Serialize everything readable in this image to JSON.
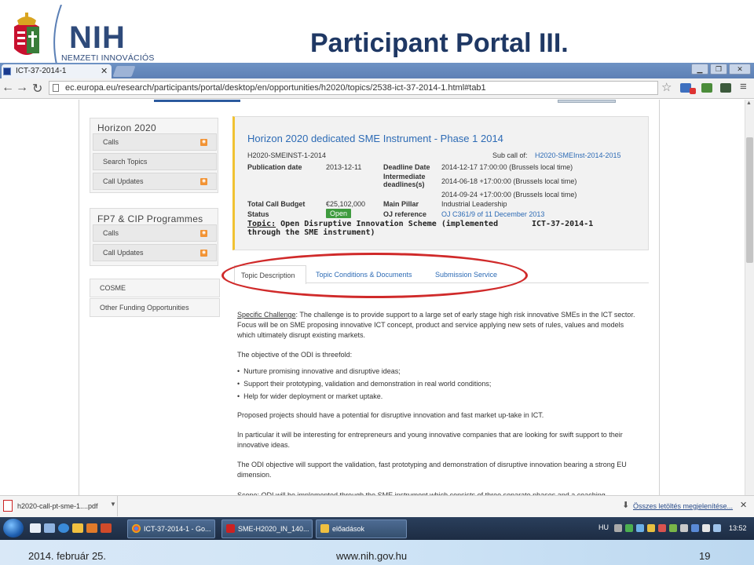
{
  "slide": {
    "title": "Participant Portal III.",
    "logo_text": "NIH",
    "logo_subtitle": "NEMZETI INNOVÁCIÓS",
    "footer_date": "2014. február 25.",
    "footer_url": "www.nih.gov.hu",
    "page_number": "19"
  },
  "browser": {
    "tab_title": "ICT-37-2014-1",
    "url": "ec.europa.eu/research/participants/portal/desktop/en/opportunities/h2020/topics/2538-ict-37-2014-1.html#tab1"
  },
  "sidebar": {
    "horizon_heading": "Horizon 2020",
    "horizon_items": [
      "Calls",
      "Search Topics",
      "Call Updates"
    ],
    "fp7_heading": "FP7 & CIP Programmes",
    "fp7_items": [
      "Calls",
      "Call Updates"
    ],
    "cosme": "COSME",
    "other_funding": "Other Funding Opportunities"
  },
  "call": {
    "title": "Horizon 2020 dedicated SME Instrument - Phase 1 2014",
    "identifier": "H2020-SMEINST-1-2014",
    "subcall_label": "Sub call of:",
    "subcall_value": "H2020-SMEInst-2014-2015",
    "publication_date_label": "Publication date",
    "publication_date": "2013-12-11",
    "deadline_label": "Deadline Date",
    "deadline": "2014-12-17 17:00:00 (Brussels local time)",
    "intermediate_label_1": "Intermediate",
    "intermediate_label_2": "deadlines(s)",
    "intermediate_1": "2014-06-18 +17:00:00 (Brussels local time)",
    "intermediate_2": "2014-09-24 +17:00:00 (Brussels local time)",
    "budget_label": "Total Call Budget",
    "budget": "€25,102,000",
    "pillar_label": "Main Pillar",
    "pillar": "Industrial Leadership",
    "status_label": "Status",
    "status": "Open",
    "oj_label": "OJ reference",
    "oj": "OJ C361/9 of 11 December 2013",
    "topic_label": "Topic:",
    "topic_text_1": " Open Disruptive Innovation Scheme (implemented",
    "topic_text_2": "through the SME instrument)",
    "topic_code": "ICT-37-2014-1"
  },
  "tabs": [
    "Topic Description",
    "Topic Conditions & Documents",
    "Submission Service"
  ],
  "body": {
    "challenge_label": "Specific Challenge",
    "challenge_text": ": The challenge is to provide support to a large set of early stage high risk innovative SMEs in the ICT sector. Focus will be on SME proposing innovative ICT concept, product and service applying new sets of rules, values and models which ultimately disrupt existing markets.",
    "objective_intro": "The objective of the ODI is threefold:",
    "bullets": [
      "Nurture promising innovative and disruptive ideas;",
      "Support their prototyping, validation and demonstration in real world conditions;",
      "Help for wider deployment or market uptake."
    ],
    "para_proposed": "Proposed projects should have a potential for disruptive innovation and fast market up-take in ICT.",
    "para_particular": "In particular it will be interesting for entrepreneurs and young innovative companies that are looking for swift support to their innovative ideas.",
    "para_odi": "The ODI objective will support the validation, fast prototyping and demonstration of disruptive innovation bearing a strong EU dimension.",
    "para_scope_cut": "Scope: ODI will be implemented through the SME instrument which consists of three separate phases and a coaching"
  },
  "download_bar": {
    "file_name": "h2020-call-pt-sme-1....pdf",
    "show_all": "Összes letöltés megjelenítése..."
  },
  "taskbar": {
    "tasks": [
      "ICT-37-2014-1 - Go...",
      "SME-H2020_IN_140...",
      "előadások"
    ],
    "lang": "HU",
    "time": "13:52"
  },
  "colors": {
    "title_blue": "#1f3864",
    "link_blue": "#2d6bb5",
    "highlight_red": "#d02a2a",
    "status_green": "#3f9b3f",
    "accent_yellow": "#f1c232"
  }
}
